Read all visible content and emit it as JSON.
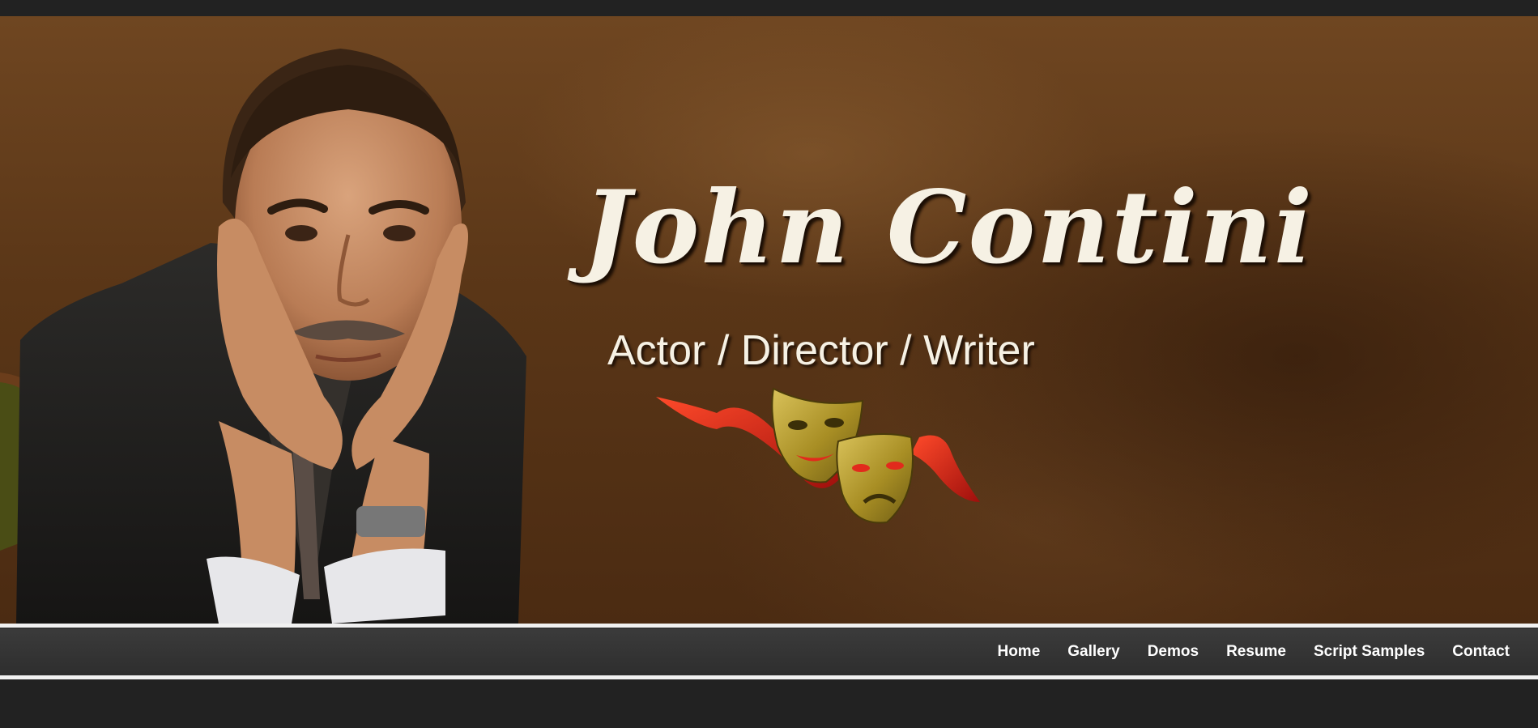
{
  "hero": {
    "name": "John Contini",
    "tagline": "Actor / Director / Writer",
    "portrait_icon": "actor-portrait",
    "emblem_icon": "comedy-tragedy-masks-icon",
    "colors": {
      "background": "#5a3617",
      "title_text": "#f6f1e4",
      "ribbon": "#d8231a",
      "mask_gold": "#b39a2c"
    }
  },
  "nav": {
    "items": [
      {
        "label": "Home"
      },
      {
        "label": "Gallery"
      },
      {
        "label": "Demos"
      },
      {
        "label": "Resume"
      },
      {
        "label": "Script Samples"
      },
      {
        "label": "Contact"
      }
    ]
  }
}
